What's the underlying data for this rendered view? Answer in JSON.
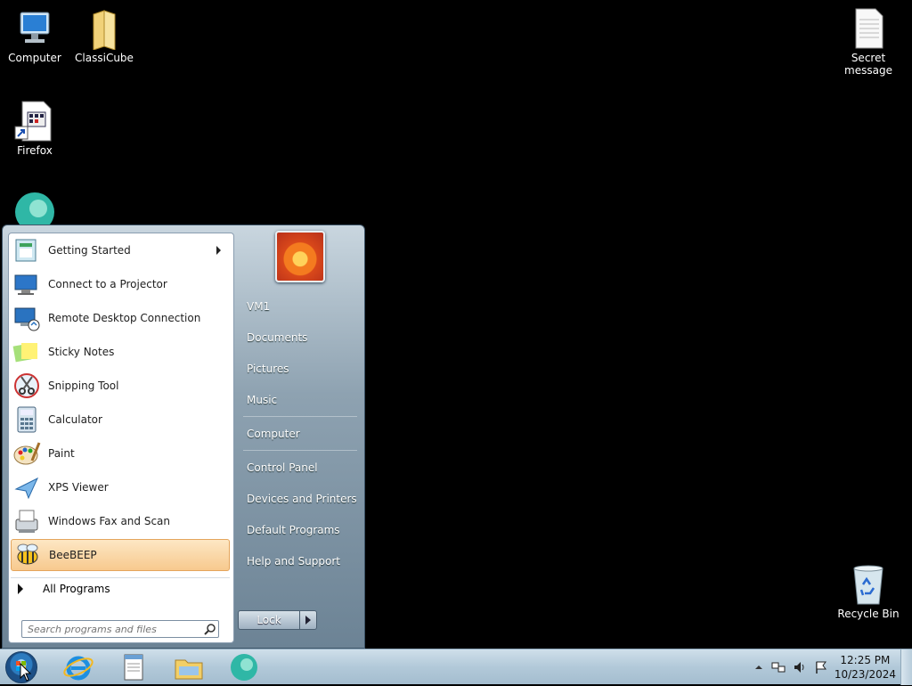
{
  "desktop": {
    "icons": [
      {
        "label": "Computer",
        "icon": "computer-icon"
      },
      {
        "label": "ClassiCube",
        "icon": "folder-icon"
      },
      {
        "label": "Firefox",
        "icon": "shortcut-file-icon"
      },
      {
        "label": "",
        "icon": "beebeep-icon"
      },
      {
        "label": "Secret\nmessage",
        "icon": "text-file-icon"
      },
      {
        "label": "Recycle Bin",
        "icon": "recycle-bin-icon"
      }
    ]
  },
  "start_menu": {
    "programs": [
      {
        "label": "Getting Started",
        "icon": "getting-started-icon",
        "submenu": true
      },
      {
        "label": "Connect to a Projector",
        "icon": "projector-icon"
      },
      {
        "label": "Remote Desktop Connection",
        "icon": "remote-desktop-icon"
      },
      {
        "label": "Sticky Notes",
        "icon": "sticky-notes-icon"
      },
      {
        "label": "Snipping Tool",
        "icon": "snipping-tool-icon"
      },
      {
        "label": "Calculator",
        "icon": "calculator-icon"
      },
      {
        "label": "Paint",
        "icon": "paint-icon"
      },
      {
        "label": "XPS Viewer",
        "icon": "xps-viewer-icon"
      },
      {
        "label": "Windows Fax and Scan",
        "icon": "fax-scan-icon"
      },
      {
        "label": "BeeBEEP",
        "icon": "beebeep-icon",
        "selected": true
      }
    ],
    "all_programs": "All Programs",
    "search_placeholder": "Search programs and files",
    "right_links": {
      "user": "VM1",
      "documents": "Documents",
      "pictures": "Pictures",
      "music": "Music",
      "computer": "Computer",
      "control_panel": "Control Panel",
      "devices": "Devices and Printers",
      "default_programs": "Default Programs",
      "help": "Help and Support"
    },
    "lock_label": "Lock"
  },
  "taskbar": {
    "pinned": [
      "internet-explorer-icon",
      "notepad-icon",
      "file-explorer-icon",
      "beebeep-icon"
    ],
    "time": "12:25 PM",
    "date": "10/23/2024"
  }
}
